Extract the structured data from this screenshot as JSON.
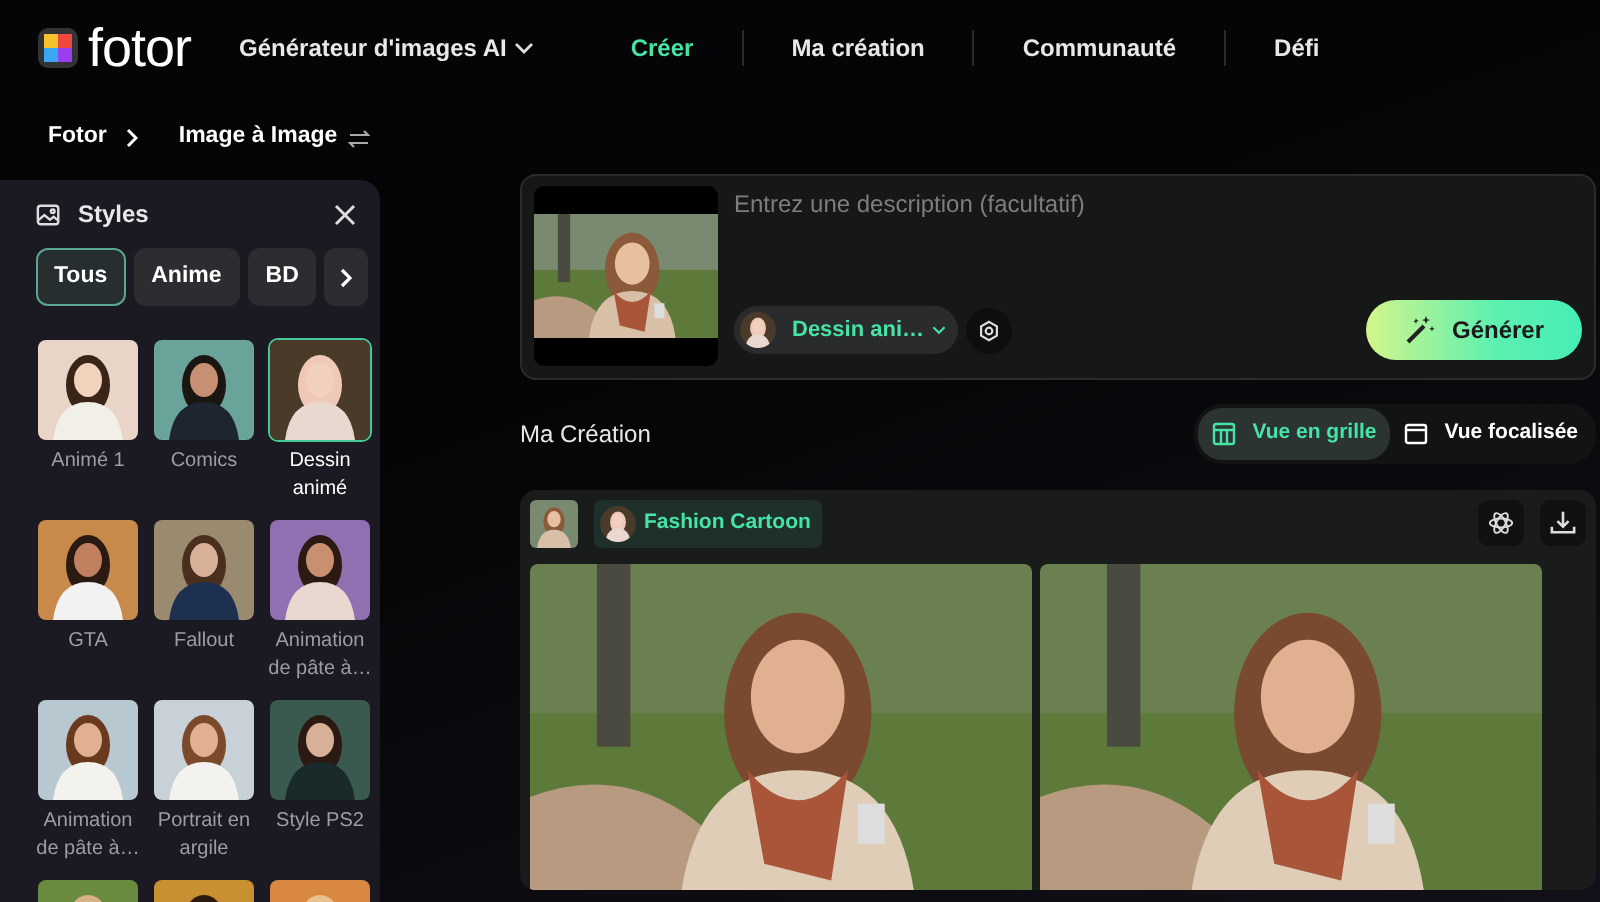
{
  "logo": {
    "text": "fotor"
  },
  "nav": [
    {
      "label": "Générateur d'images AI",
      "kind": "dropdown",
      "selected": false
    },
    {
      "label": "Créer",
      "kind": "link",
      "selected": true
    },
    {
      "label": "Ma création",
      "kind": "link",
      "selected": false
    },
    {
      "label": "Communauté",
      "kind": "link",
      "selected": false
    },
    {
      "label": "Défi",
      "kind": "link",
      "selected": false
    }
  ],
  "breadcrumb": [
    {
      "label": "Fotor",
      "kind": "link"
    },
    {
      "label": "Image à Image",
      "kind": "current"
    }
  ],
  "styles_panel": {
    "title": "Styles",
    "filters": [
      {
        "label": "Tous",
        "selected": true
      },
      {
        "label": "Anime",
        "selected": false
      },
      {
        "label": "BD",
        "selected": false
      }
    ],
    "tiles": [
      {
        "label": "Animé 1",
        "selected": false
      },
      {
        "label": "Comics",
        "selected": false
      },
      {
        "label": "Dessin animé",
        "selected": true
      },
      {
        "label": "GTA",
        "selected": false
      },
      {
        "label": "Fallout",
        "selected": false
      },
      {
        "label": "Animation de pâte à…",
        "selected": false
      },
      {
        "label": "Animation de pâte à…",
        "selected": false
      },
      {
        "label": "Portrait en argile",
        "selected": false
      },
      {
        "label": "Style PS2",
        "selected": false
      },
      {
        "selected": false
      },
      {
        "selected": false
      },
      {
        "selected": false
      }
    ]
  },
  "prompt": {
    "placeholder": "Entrez une description (facultatif)",
    "style_select": "Dessin ani…",
    "generate_button": "Générer"
  },
  "creation": {
    "title": "Ma Création",
    "views": [
      {
        "label": "Vue en grille",
        "kind": "grid",
        "selected": true
      },
      {
        "label": "Vue focalisée",
        "kind": "focus",
        "selected": false
      }
    ],
    "style_tag": "Fashion Cartoon"
  }
}
